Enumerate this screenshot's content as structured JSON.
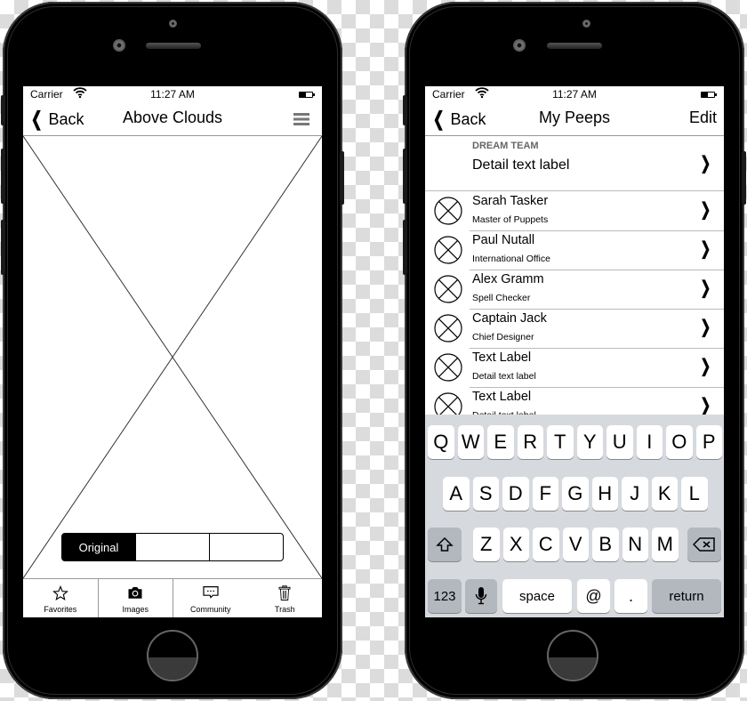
{
  "left_phone": {
    "status": {
      "carrier": "Carrier",
      "time": "11:27 AM"
    },
    "nav": {
      "back_label": "Back",
      "title": "Above Clouds"
    },
    "segmented": [
      "Original",
      "",
      ""
    ],
    "tabs": [
      {
        "icon": "star-icon",
        "glyph": "☆",
        "label": "Favorites"
      },
      {
        "icon": "camera-icon",
        "glyph": "📷",
        "label": "Images"
      },
      {
        "icon": "chat-bubble-icon",
        "glyph": "💬",
        "label": "Community"
      },
      {
        "icon": "trash-icon",
        "glyph": "🗑",
        "label": "Trash"
      }
    ]
  },
  "right_phone": {
    "status": {
      "carrier": "Carrier",
      "time": "11:27 AM"
    },
    "nav": {
      "back_label": "Back",
      "title": "My Peeps",
      "edit_label": "Edit"
    },
    "section": {
      "header": "DREAM TEAM",
      "detail": "Detail text label"
    },
    "rows": [
      {
        "name": "Sarah Tasker",
        "subtitle": "Master of Puppets"
      },
      {
        "name": "Paul Nutall",
        "subtitle": "International Office"
      },
      {
        "name": "Alex Gramm",
        "subtitle": "Spell Checker"
      },
      {
        "name": "Captain Jack",
        "subtitle": "Chief Designer"
      },
      {
        "name": "Text Label",
        "subtitle": "Detail text label"
      },
      {
        "name": "Text Label",
        "subtitle": "Detail text label"
      }
    ],
    "keyboard": {
      "row1": [
        "Q",
        "W",
        "E",
        "R",
        "T",
        "Y",
        "U",
        "I",
        "O",
        "P"
      ],
      "row2": [
        "A",
        "S",
        "D",
        "F",
        "G",
        "H",
        "J",
        "K",
        "L"
      ],
      "row3": [
        "Z",
        "X",
        "C",
        "V",
        "B",
        "N",
        "M"
      ],
      "numbers_label": "123",
      "space_label": "space",
      "at_label": "@",
      "dot_label": ".",
      "return_label": "return"
    }
  }
}
